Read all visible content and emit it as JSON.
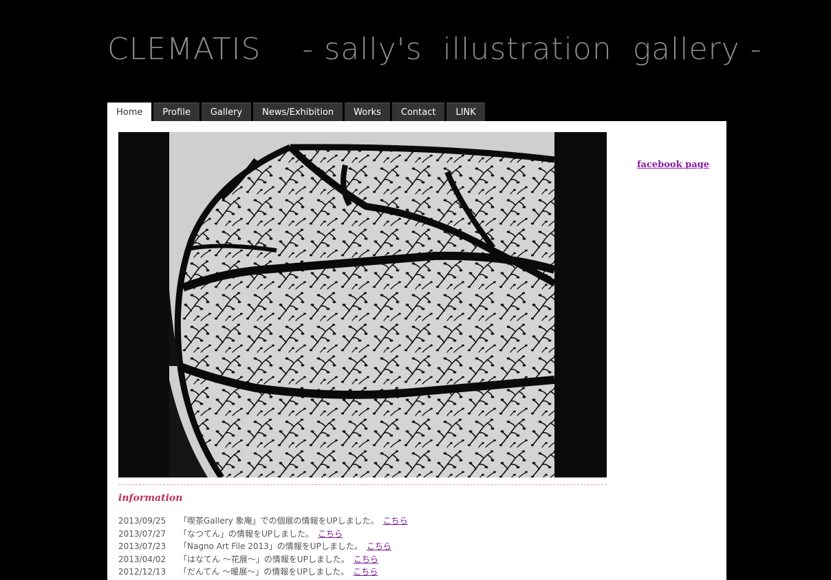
{
  "header": {
    "title": "CLEMATIS    - sally's  illustration  gallery -"
  },
  "nav": {
    "tabs": [
      {
        "label": "Home",
        "active": true
      },
      {
        "label": "Profile",
        "active": false
      },
      {
        "label": "Gallery",
        "active": false
      },
      {
        "label": "News/Exhibition",
        "active": false
      },
      {
        "label": "Works",
        "active": false
      },
      {
        "label": "Contact",
        "active": false
      },
      {
        "label": "LINK",
        "active": false
      }
    ]
  },
  "sidebar": {
    "facebook_link": "facebook  page"
  },
  "information": {
    "heading": "information",
    "items": [
      {
        "date": "2013/09/25",
        "text": "「喫茶Gallery 象庵」での個展の情報をUPしました。",
        "link": "こちら"
      },
      {
        "date": "2013/07/27",
        "text": "「なつてん」の情報をUPしました。",
        "link": "こちら"
      },
      {
        "date": "2013/07/23",
        "text": "「Nagno Art File  2013」の情報をUPしました。",
        "link": "こちら"
      },
      {
        "date": "2013/04/02",
        "text": "「はなてん ～花展～」の情報をUPしました。",
        "link": "こちら"
      },
      {
        "date": "2012/12/13",
        "text": "「だんてん ～暖展～」の情報をUPしました。",
        "link": "こちら"
      }
    ]
  },
  "colors": {
    "page_background": "#000000",
    "tab_background": "#333333",
    "link": "#7a1a98",
    "information_heading": "#c0315b",
    "divider": "#e59bb3"
  }
}
